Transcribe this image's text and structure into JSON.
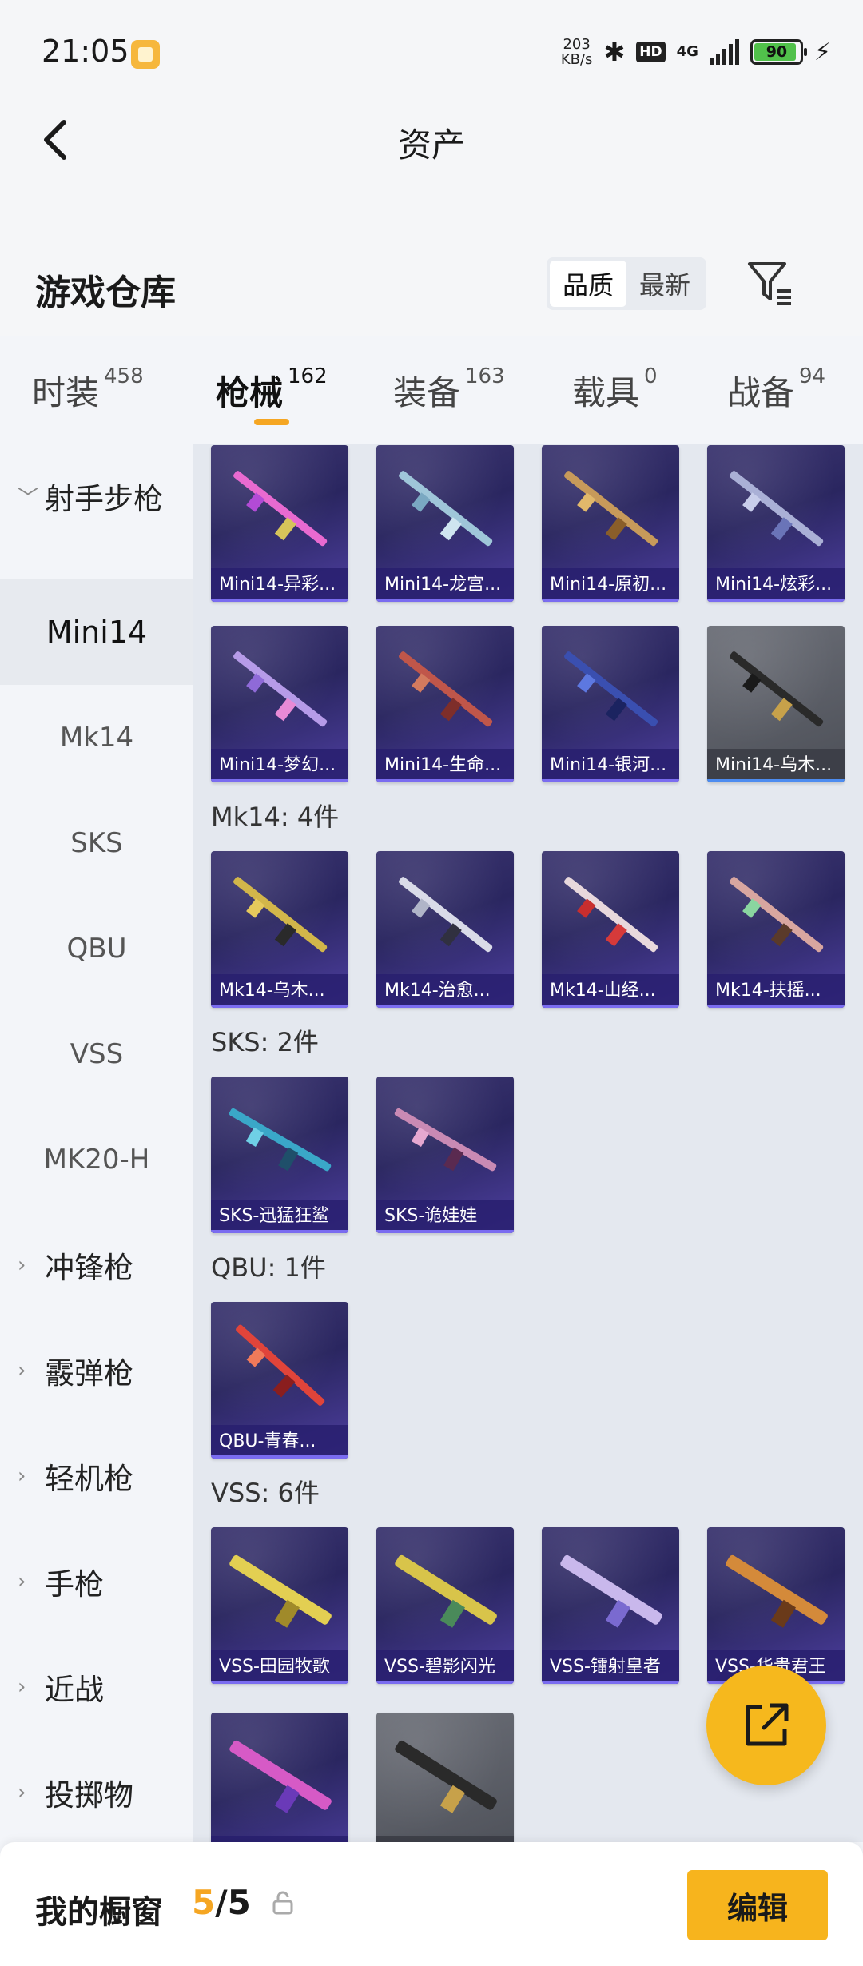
{
  "status_bar": {
    "time": "21:05",
    "net_speed_value": "203",
    "net_speed_unit": "KB/s",
    "hd": "HD",
    "network": "4G",
    "battery": "90",
    "icons": [
      "app-notification-icon",
      "bluetooth-icon",
      "signal-icon",
      "battery-icon",
      "charging-icon"
    ]
  },
  "header": {
    "title": "资产"
  },
  "repo": {
    "title": "游戏仓库",
    "sort_options": [
      "品质",
      "最新"
    ],
    "active_sort": "品质"
  },
  "tabs": [
    {
      "label": "时装",
      "count": "458"
    },
    {
      "label": "枪械",
      "count": "162"
    },
    {
      "label": "装备",
      "count": "163"
    },
    {
      "label": "载具",
      "count": "0"
    },
    {
      "label": "战备",
      "count": "94"
    }
  ],
  "active_tab": "枪械",
  "sidebar": {
    "category_expanded": "射手步枪",
    "sub_items": [
      "Mini14",
      "Mk14",
      "SKS",
      "QBU",
      "VSS",
      "MK20-H"
    ],
    "active_sub": "Mini14",
    "categories": [
      "冲锋枪",
      "霰弹枪",
      "轻机枪",
      "手枪",
      "近战",
      "投掷物"
    ]
  },
  "sections": [
    {
      "header": "",
      "items": [
        "Mini14-异彩...",
        "Mini14-龙宫...",
        "Mini14-原初...",
        "Mini14-炫彩...",
        "Mini14-梦幻...",
        "Mini14-生命...",
        "Mini14-银河...",
        "Mini14-乌木..."
      ]
    },
    {
      "header": "Mk14: 4件",
      "items": [
        "Mk14-乌木...",
        "Mk14-治愈...",
        "Mk14-山经...",
        "Mk14-扶摇..."
      ]
    },
    {
      "header": "SKS: 2件",
      "items": [
        "SKS-迅猛狂鲨",
        "SKS-诡娃娃"
      ]
    },
    {
      "header": "QBU: 1件",
      "items": [
        "QBU-青春..."
      ]
    },
    {
      "header": "VSS: 6件",
      "items": [
        "VSS-田园牧歌",
        "VSS-碧影闪光",
        "VSS-镭射皇者",
        "VSS-华贵君王",
        "",
        ""
      ]
    }
  ],
  "bottom": {
    "window_label": "我的橱窗",
    "window_current": "5",
    "window_total": "/5",
    "edit_label": "编辑"
  },
  "colors": {
    "accent": "#f5a623",
    "card_purple": "#3c3670",
    "edit_button": "#f7b41d"
  }
}
